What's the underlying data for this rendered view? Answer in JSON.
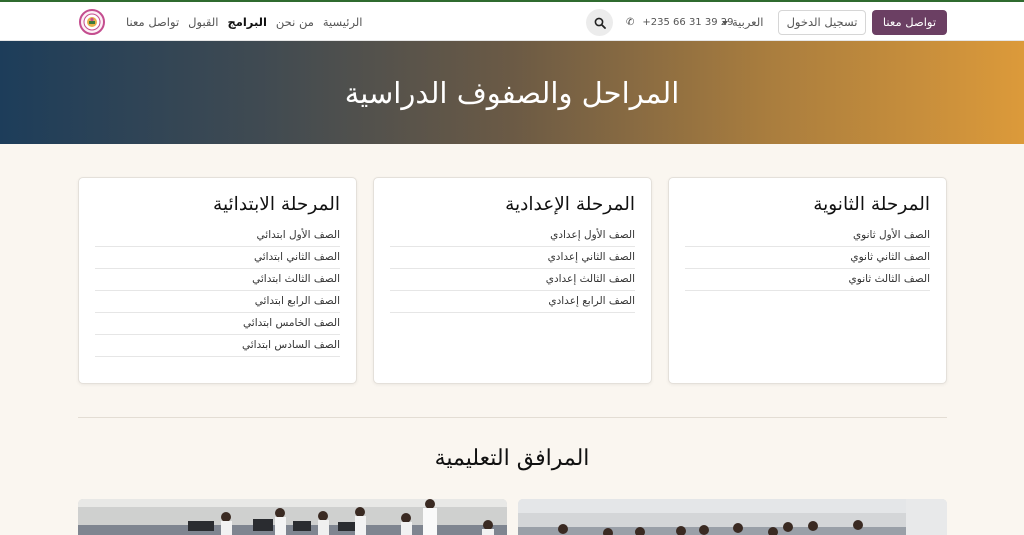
{
  "navbar": {
    "contact_button": "تواصل معنا",
    "login_button": "تسجيل الدخول",
    "language": "العربية",
    "phone": "+235 66 31 39 29",
    "links": [
      {
        "label": "تواصل معنا",
        "active": false
      },
      {
        "label": "القبول",
        "active": false
      },
      {
        "label": "البرامج",
        "active": true
      },
      {
        "label": "من نحن",
        "active": false
      },
      {
        "label": "الرئيسية",
        "active": false
      }
    ],
    "icons": {
      "search": "search-icon",
      "phone": "phone-icon",
      "logo": "school-logo-icon"
    }
  },
  "hero": {
    "title": "المراحل والصفوف الدراسية",
    "gradient_start": "#1d3d5a",
    "gradient_end": "#dc9a3a"
  },
  "stages": [
    {
      "title": "المرحلة الابتدائية",
      "grades": [
        "الصف الأول ابتدائي",
        "الصف الثاني ابتدائي",
        "الصف الثالث ابتدائي",
        "الصف الرابع ابتدائي",
        "الصف الخامس ابتدائي",
        "الصف السادس ابتدائي"
      ]
    },
    {
      "title": "المرحلة الإعدادية",
      "grades": [
        "الصف الأول إعدادي",
        "الصف الثاني إعدادي",
        "الصف الثالث إعدادي",
        "الصف الرابع إعدادي"
      ]
    },
    {
      "title": "المرحلة الثانوية",
      "grades": [
        "الصف الأول ثانوي",
        "الصف الثاني ثانوي",
        "الصف الثالث ثانوي"
      ]
    }
  ],
  "facilities": {
    "title": "المرافق التعليمية"
  },
  "colors": {
    "primary": "#6b3f63",
    "top_accent": "#2f6b2f",
    "page_background": "#faf6f0"
  }
}
